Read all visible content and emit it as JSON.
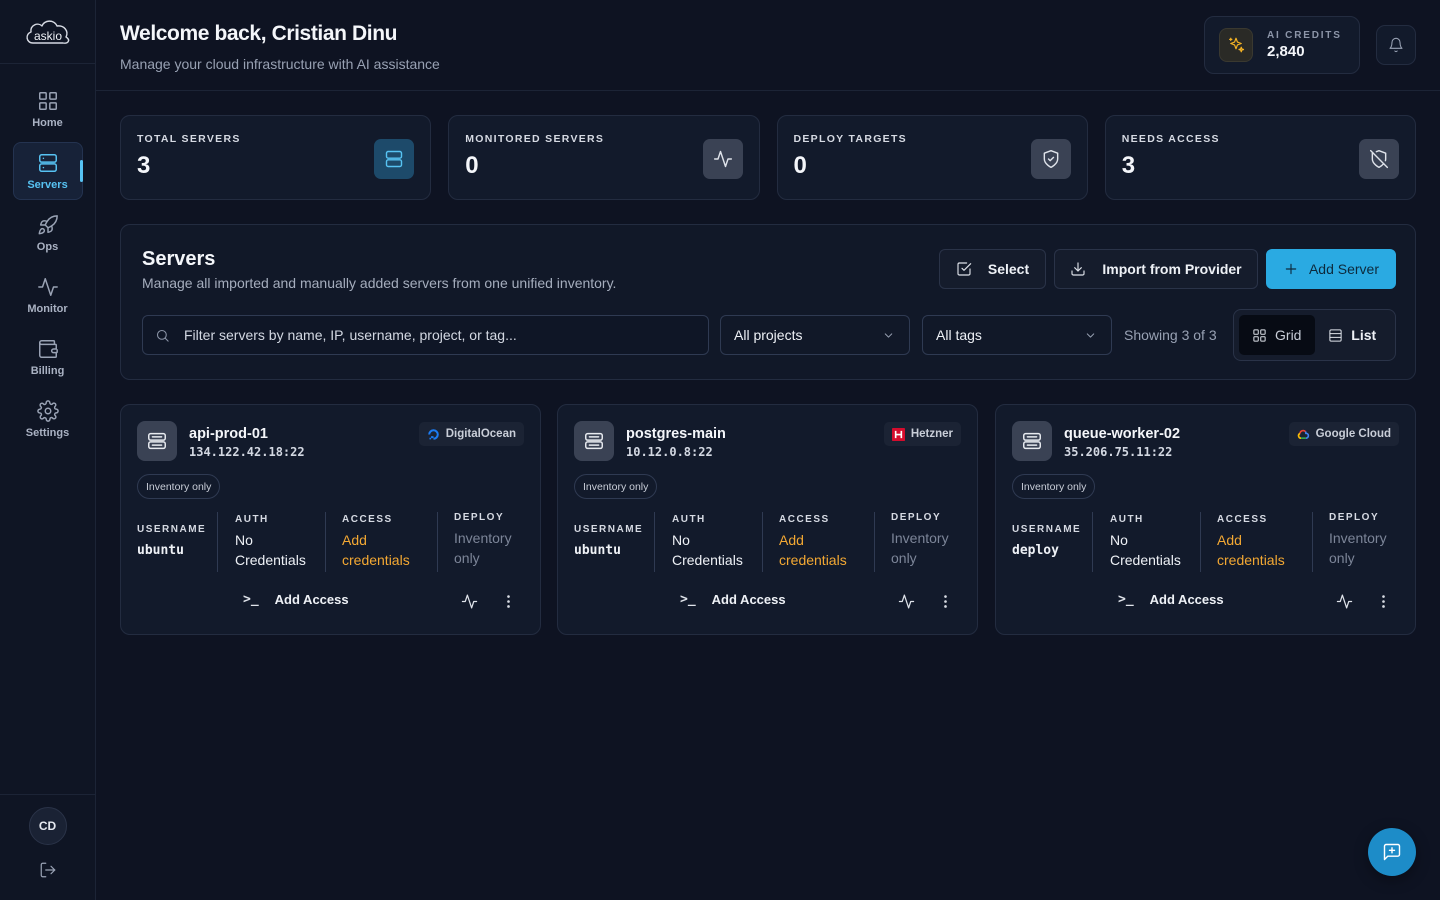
{
  "app": {
    "logo_text": "askio"
  },
  "sidebar": {
    "items": [
      {
        "label": "Home",
        "icon": "grid-icon",
        "active": false
      },
      {
        "label": "Servers",
        "icon": "server-icon",
        "active": true
      },
      {
        "label": "Ops",
        "icon": "rocket-icon",
        "active": false
      },
      {
        "label": "Monitor",
        "icon": "activity-icon",
        "active": false
      },
      {
        "label": "Billing",
        "icon": "wallet-icon",
        "active": false
      },
      {
        "label": "Settings",
        "icon": "gear-icon",
        "active": false
      }
    ],
    "user_initials": "CD"
  },
  "header": {
    "title": "Welcome back, Cristian Dinu",
    "subtitle": "Manage your cloud infrastructure with AI assistance",
    "credits_label": "AI CREDITS",
    "credits_value": "2,840"
  },
  "stats": [
    {
      "label": "TOTAL SERVERS",
      "value": "3",
      "icon": "server-icon"
    },
    {
      "label": "MONITORED SERVERS",
      "value": "0",
      "icon": "activity-icon"
    },
    {
      "label": "DEPLOY TARGETS",
      "value": "0",
      "icon": "shield-check-icon"
    },
    {
      "label": "NEEDS ACCESS",
      "value": "3",
      "icon": "shield-off-icon"
    }
  ],
  "servers_panel": {
    "title": "Servers",
    "description": "Manage all imported and manually added servers from one unified inventory.",
    "select_label": "Select",
    "import_label": "Import from Provider",
    "add_label": "Add Server",
    "search_placeholder": "Filter servers by name, IP, username, project, or tag...",
    "projects_filter": "All projects",
    "tags_filter": "All tags",
    "showing": "Showing 3 of 3",
    "view_grid": "Grid",
    "view_list": "List"
  },
  "server_cards": [
    {
      "name": "api-prod-01",
      "address": "134.122.42.18:22",
      "provider": "DigitalOcean",
      "badge": "Inventory only",
      "username_label": "USERNAME",
      "username": "ubuntu",
      "auth_label": "AUTH",
      "auth": "No Credentials",
      "access_label": "ACCESS",
      "access": "Add credentials",
      "deploy_label": "DEPLOY",
      "deploy": "Inventory only",
      "add_access": "Add Access"
    },
    {
      "name": "postgres-main",
      "address": "10.12.0.8:22",
      "provider": "Hetzner",
      "badge": "Inventory only",
      "username_label": "USERNAME",
      "username": "ubuntu",
      "auth_label": "AUTH",
      "auth": "No Credentials",
      "access_label": "ACCESS",
      "access": "Add credentials",
      "deploy_label": "DEPLOY",
      "deploy": "Inventory only",
      "add_access": "Add Access"
    },
    {
      "name": "queue-worker-02",
      "address": "35.206.75.11:22",
      "provider": "Google Cloud",
      "badge": "Inventory only",
      "username_label": "USERNAME",
      "username": "deploy",
      "auth_label": "AUTH",
      "auth": "No Credentials",
      "access_label": "ACCESS",
      "access": "Add credentials",
      "deploy_label": "DEPLOY",
      "deploy": "Inventory only",
      "add_access": "Add Access"
    }
  ],
  "colors": {
    "accent": "#2aaae2",
    "warning_link": "#f3a833",
    "background": "#0e1322"
  }
}
